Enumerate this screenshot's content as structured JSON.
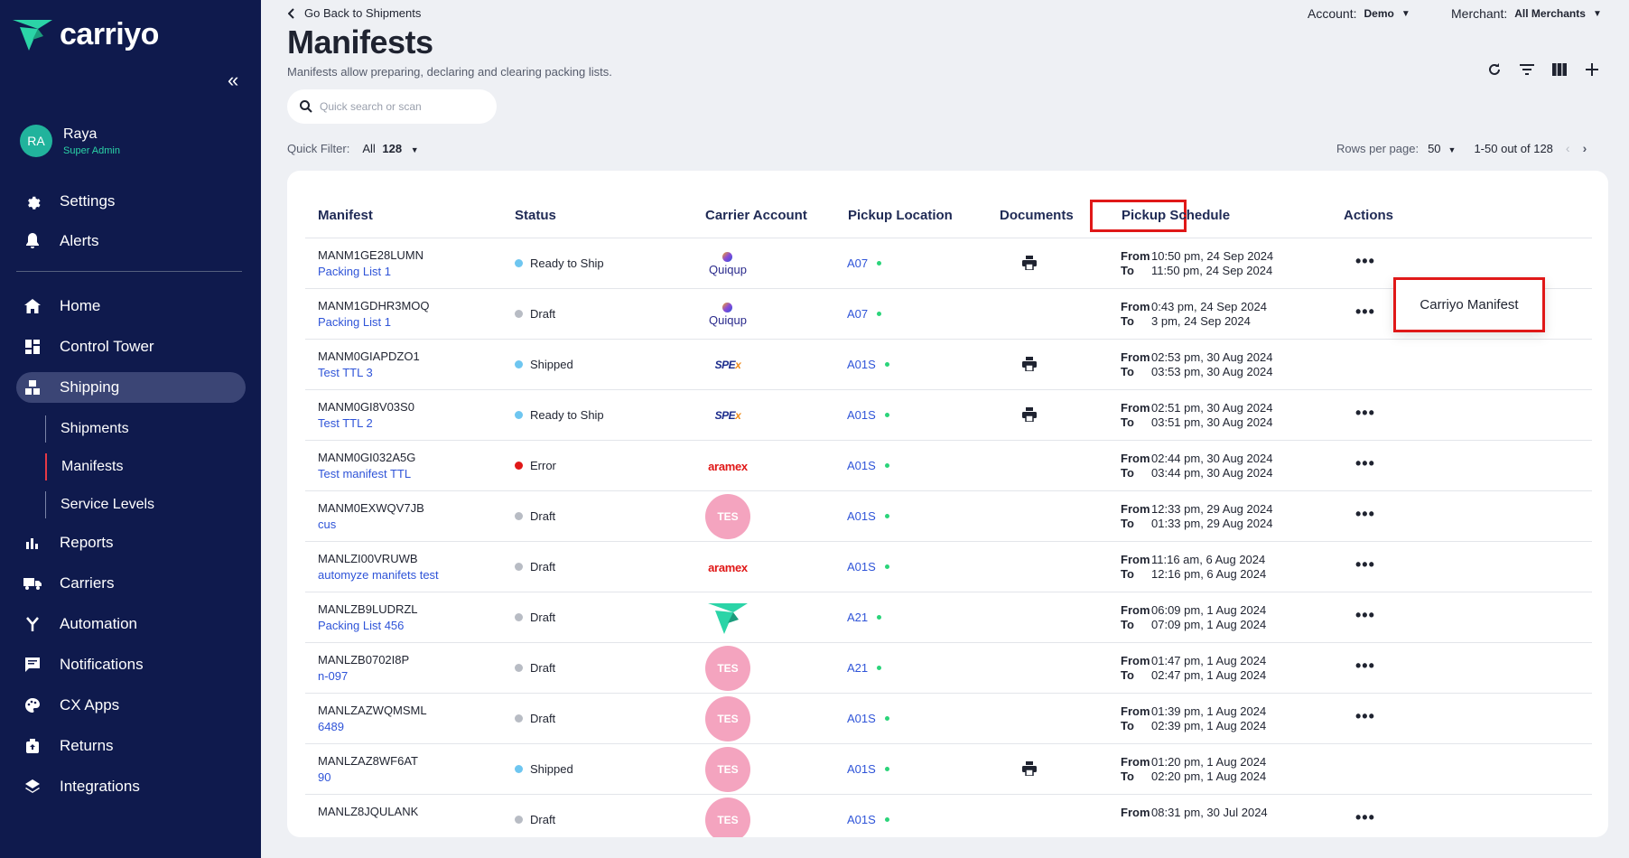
{
  "brand": {
    "name": "carriyo",
    "accent": "#2bd4a7",
    "sidebar_bg": "#0f1a4d"
  },
  "user": {
    "initials": "RA",
    "name": "Raya",
    "role": "Super Admin"
  },
  "nav": {
    "settings": "Settings",
    "alerts": "Alerts",
    "home": "Home",
    "control_tower": "Control Tower",
    "shipping": "Shipping",
    "shipments": "Shipments",
    "manifests": "Manifests",
    "service_levels": "Service Levels",
    "reports": "Reports",
    "carriers": "Carriers",
    "automation": "Automation",
    "notifications": "Notifications",
    "cx_apps": "CX Apps",
    "returns": "Returns",
    "integrations": "Integrations"
  },
  "header": {
    "back": "Go Back to Shipments",
    "title": "Manifests",
    "subtitle": "Manifests allow preparing, declaring and clearing packing lists.",
    "account_label": "Account:",
    "account_value": "Demo",
    "merchant_label": "Merchant:",
    "merchant_value": "All Merchants"
  },
  "search": {
    "placeholder": "Quick search or scan"
  },
  "quick_filter": {
    "label": "Quick Filter:",
    "value": "All",
    "count": "128"
  },
  "pager": {
    "rows_label": "Rows per page:",
    "rows_value": "50",
    "range": "1-50 out of 128"
  },
  "columns": {
    "manifest": "Manifest",
    "status": "Status",
    "carrier": "Carrier Account",
    "pickup": "Pickup Location",
    "documents": "Documents",
    "schedule": "Pickup Schedule",
    "actions": "Actions"
  },
  "from_label": "From",
  "to_label": "To",
  "popup": {
    "label": "Carriyo Manifest"
  },
  "carrier_labels": {
    "quiqup": "Quiqup",
    "spex_main": "SPE",
    "spex_x": "x",
    "aramex": "aramex",
    "tes": "TES"
  },
  "status_colors": {
    "blue": "#6ec6f0",
    "grey": "#b8bcc4",
    "red": "#e01818"
  },
  "rows": [
    {
      "id": "MANM1GE28LUMN",
      "list": "Packing List 1",
      "status": "Ready to Ship",
      "color": "#6ec6f0",
      "carrier": "quiqup",
      "loc": "A07",
      "doc": true,
      "from": "10:50 pm, 24 Sep 2024",
      "to": "11:50 pm, 24 Sep 2024",
      "actions": true
    },
    {
      "id": "MANM1GDHR3MOQ",
      "list": "Packing List 1",
      "status": "Draft",
      "color": "#b8bcc4",
      "carrier": "quiqup",
      "loc": "A07",
      "doc": false,
      "from": "0:43 pm, 24 Sep 2024",
      "to": "3 pm, 24 Sep 2024",
      "actions": true
    },
    {
      "id": "MANM0GIAPDZO1",
      "list": "Test TTL 3",
      "status": "Shipped",
      "color": "#6ec6f0",
      "carrier": "spex",
      "loc": "A01S",
      "doc": true,
      "from": "02:53 pm, 30 Aug 2024",
      "to": "03:53 pm, 30 Aug 2024",
      "actions": false
    },
    {
      "id": "MANM0GI8V03S0",
      "list": "Test TTL 2",
      "status": "Ready to Ship",
      "color": "#6ec6f0",
      "carrier": "spex",
      "loc": "A01S",
      "doc": true,
      "from": "02:51 pm, 30 Aug 2024",
      "to": "03:51 pm, 30 Aug 2024",
      "actions": true
    },
    {
      "id": "MANM0GI032A5G",
      "list": "Test manifest TTL",
      "status": "Error",
      "color": "#e01818",
      "carrier": "aramex",
      "loc": "A01S",
      "doc": false,
      "from": "02:44 pm, 30 Aug 2024",
      "to": "03:44 pm, 30 Aug 2024",
      "actions": true
    },
    {
      "id": "MANM0EXWQV7JB",
      "list": "cus",
      "status": "Draft",
      "color": "#b8bcc4",
      "carrier": "tes",
      "loc": "A01S",
      "doc": false,
      "from": "12:33 pm, 29 Aug 2024",
      "to": "01:33 pm, 29 Aug 2024",
      "actions": true
    },
    {
      "id": "MANLZI00VRUWB",
      "list": "automyze manifets test",
      "status": "Draft",
      "color": "#b8bcc4",
      "carrier": "aramex",
      "loc": "A01S",
      "doc": false,
      "from": "11:16 am, 6 Aug 2024",
      "to": "12:16 pm, 6 Aug 2024",
      "actions": true
    },
    {
      "id": "MANLZB9LUDRZL",
      "list": "Packing List 456",
      "status": "Draft",
      "color": "#b8bcc4",
      "carrier": "carriyo",
      "loc": "A21",
      "doc": false,
      "from": "06:09 pm, 1 Aug 2024",
      "to": "07:09 pm, 1 Aug 2024",
      "actions": true
    },
    {
      "id": "MANLZB0702I8P",
      "list": "n-097",
      "status": "Draft",
      "color": "#b8bcc4",
      "carrier": "tes",
      "loc": "A21",
      "doc": false,
      "from": "01:47 pm, 1 Aug 2024",
      "to": "02:47 pm, 1 Aug 2024",
      "actions": true
    },
    {
      "id": "MANLZAZWQMSML",
      "list": "6489",
      "status": "Draft",
      "color": "#b8bcc4",
      "carrier": "tes",
      "loc": "A01S",
      "doc": false,
      "from": "01:39 pm, 1 Aug 2024",
      "to": "02:39 pm, 1 Aug 2024",
      "actions": true
    },
    {
      "id": "MANLZAZ8WF6AT",
      "list": "90",
      "status": "Shipped",
      "color": "#6ec6f0",
      "carrier": "tes",
      "loc": "A01S",
      "doc": true,
      "from": "01:20 pm, 1 Aug 2024",
      "to": "02:20 pm, 1 Aug 2024",
      "actions": false
    },
    {
      "id": "MANLZ8JQULANK",
      "list": "",
      "status": "Draft",
      "color": "#b8bcc4",
      "carrier": "tes",
      "loc": "A01S",
      "doc": false,
      "from": "08:31 pm, 30 Jul 2024",
      "to": "",
      "actions": true
    }
  ]
}
